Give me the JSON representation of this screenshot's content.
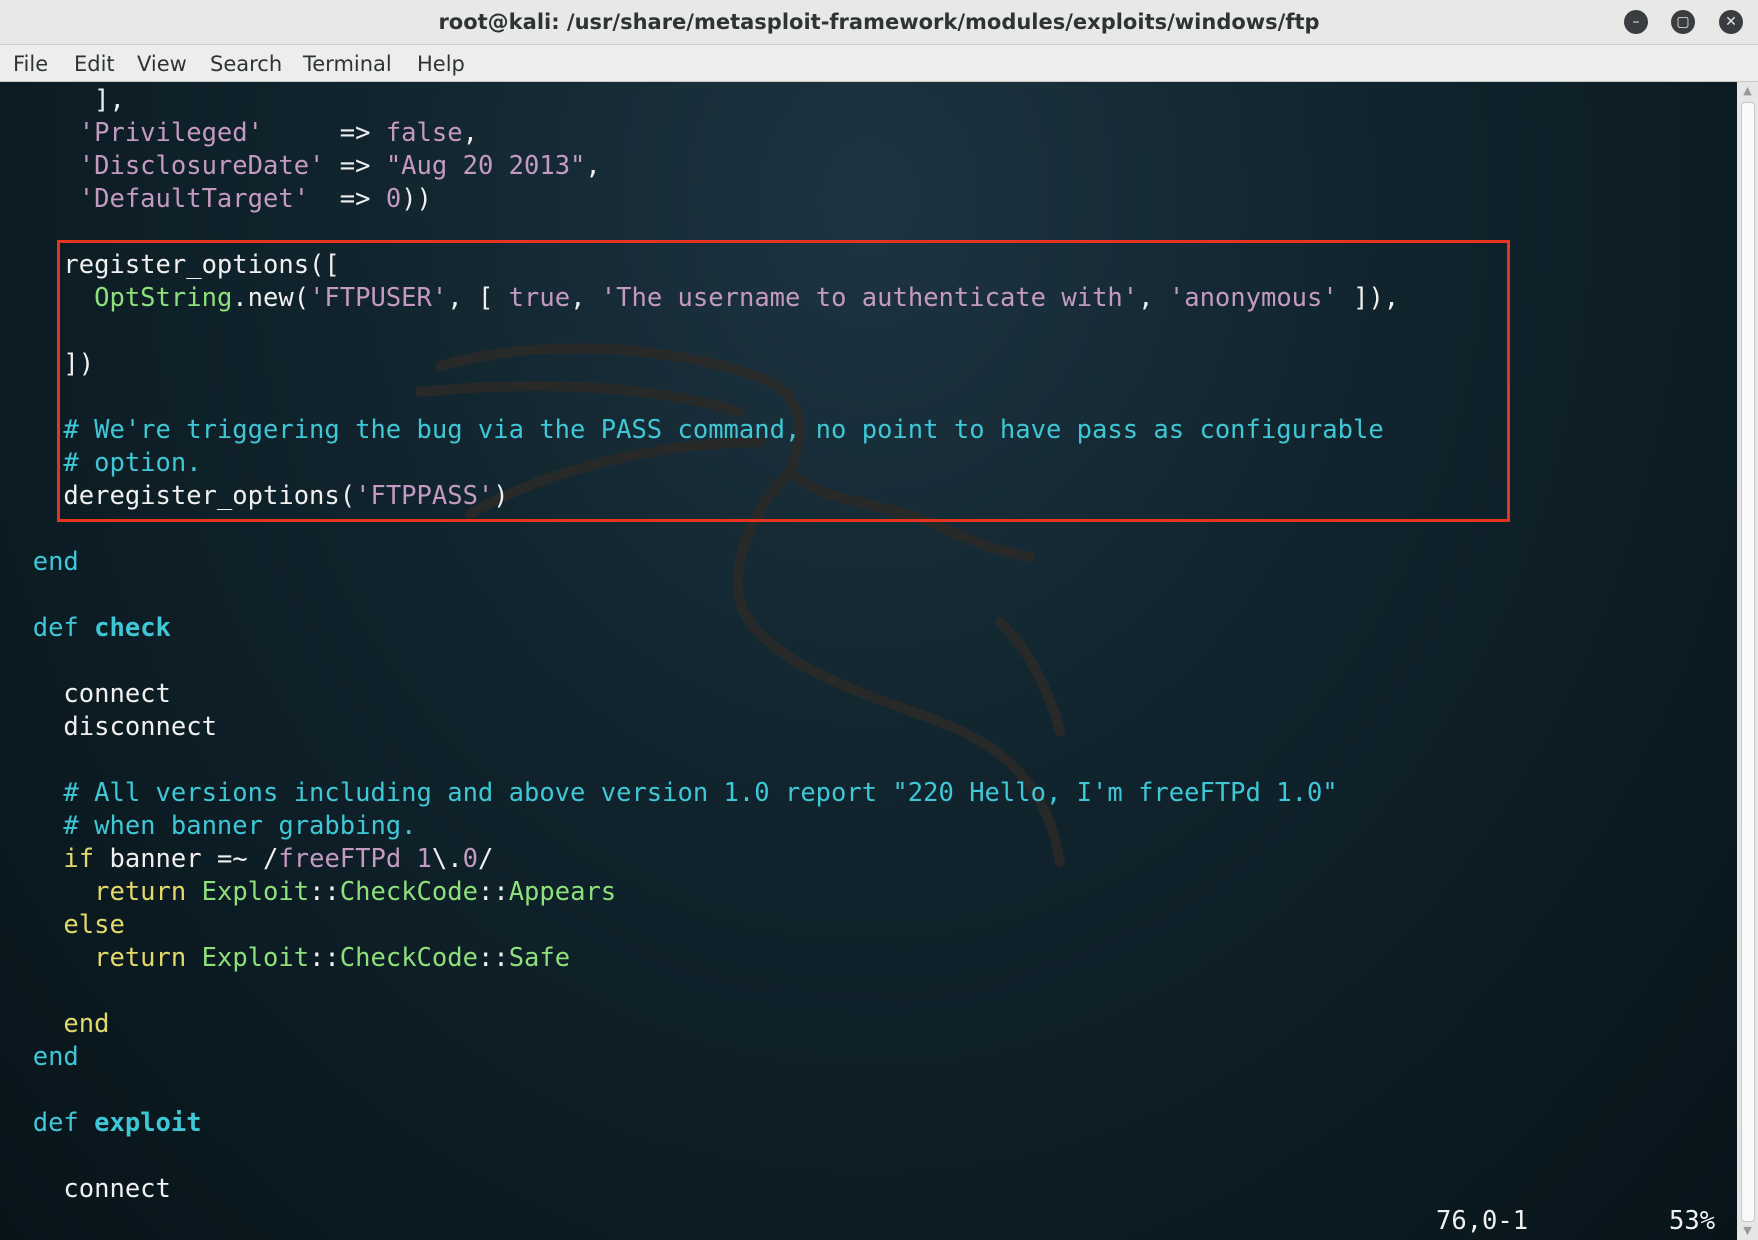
{
  "window": {
    "title": "root@kali: /usr/share/metasploit-framework/modules/exploits/windows/ftp",
    "minimize_glyph": "–",
    "maximize_glyph": "▢",
    "close_glyph": "✕"
  },
  "menu": [
    "File",
    "Edit",
    "View",
    "Search",
    "Terminal",
    "Help"
  ],
  "code": [
    [
      {
        "t": "      ],",
        "c": ""
      }
    ],
    [
      {
        "t": "     ",
        "c": ""
      },
      {
        "t": "'Privileged'",
        "c": "str"
      },
      {
        "t": "     => ",
        "c": ""
      },
      {
        "t": "false",
        "c": "str"
      },
      {
        "t": ",",
        "c": ""
      }
    ],
    [
      {
        "t": "     ",
        "c": ""
      },
      {
        "t": "'DisclosureDate'",
        "c": "str"
      },
      {
        "t": " => ",
        "c": ""
      },
      {
        "t": "\"Aug 20 2013\"",
        "c": "str"
      },
      {
        "t": ",",
        "c": ""
      }
    ],
    [
      {
        "t": "     ",
        "c": ""
      },
      {
        "t": "'DefaultTarget'",
        "c": "str"
      },
      {
        "t": "  => ",
        "c": ""
      },
      {
        "t": "0",
        "c": "str"
      },
      {
        "t": "))",
        "c": ""
      }
    ],
    [],
    [
      {
        "t": "    register_options([",
        "c": ""
      }
    ],
    [
      {
        "t": "      ",
        "c": ""
      },
      {
        "t": "OptString",
        "c": "grn"
      },
      {
        "t": ".new(",
        "c": ""
      },
      {
        "t": "'FTPUSER'",
        "c": "str"
      },
      {
        "t": ", [ ",
        "c": ""
      },
      {
        "t": "true",
        "c": "str"
      },
      {
        "t": ", ",
        "c": ""
      },
      {
        "t": "'The username to authenticate with'",
        "c": "str"
      },
      {
        "t": ", ",
        "c": ""
      },
      {
        "t": "'anonymous'",
        "c": "str"
      },
      {
        "t": " ]),",
        "c": ""
      }
    ],
    [],
    [
      {
        "t": "    ])",
        "c": ""
      }
    ],
    [],
    [
      {
        "t": "    # We're triggering the bug via the PASS command, no point to have pass as configurable",
        "c": "cmt"
      }
    ],
    [
      {
        "t": "    # option.",
        "c": "cmt"
      }
    ],
    [
      {
        "t": "    deregister_options(",
        "c": ""
      },
      {
        "t": "'FTPPASS'",
        "c": "str"
      },
      {
        "t": ")",
        "c": ""
      }
    ],
    [],
    [
      {
        "t": "  ",
        "c": ""
      },
      {
        "t": "end",
        "c": "cyan"
      }
    ],
    [],
    [
      {
        "t": "  ",
        "c": ""
      },
      {
        "t": "def",
        "c": "cyan"
      },
      {
        "t": " ",
        "c": ""
      },
      {
        "t": "check",
        "c": "cyanb"
      }
    ],
    [],
    [
      {
        "t": "    connect",
        "c": ""
      }
    ],
    [
      {
        "t": "    disconnect",
        "c": ""
      }
    ],
    [],
    [
      {
        "t": "    # All versions including and above version 1.0 report \"220 Hello, I'm freeFTPd 1.0\"",
        "c": "cmt"
      }
    ],
    [
      {
        "t": "    # when banner grabbing.",
        "c": "cmt"
      }
    ],
    [
      {
        "t": "    ",
        "c": ""
      },
      {
        "t": "if",
        "c": "yel"
      },
      {
        "t": " banner =~ ",
        "c": ""
      },
      {
        "t": "/",
        "c": ""
      },
      {
        "t": "freeFTPd 1",
        "c": "str"
      },
      {
        "t": "\\.",
        "c": ""
      },
      {
        "t": "0",
        "c": "str"
      },
      {
        "t": "/",
        "c": ""
      }
    ],
    [
      {
        "t": "      ",
        "c": ""
      },
      {
        "t": "return",
        "c": "yel"
      },
      {
        "t": " ",
        "c": ""
      },
      {
        "t": "Exploit",
        "c": "grn"
      },
      {
        "t": "::",
        "c": ""
      },
      {
        "t": "CheckCode",
        "c": "grn"
      },
      {
        "t": "::",
        "c": ""
      },
      {
        "t": "Appears",
        "c": "grn"
      }
    ],
    [
      {
        "t": "    ",
        "c": ""
      },
      {
        "t": "else",
        "c": "yel"
      }
    ],
    [
      {
        "t": "      ",
        "c": ""
      },
      {
        "t": "return",
        "c": "yel"
      },
      {
        "t": " ",
        "c": ""
      },
      {
        "t": "Exploit",
        "c": "grn"
      },
      {
        "t": "::",
        "c": ""
      },
      {
        "t": "CheckCode",
        "c": "grn"
      },
      {
        "t": "::",
        "c": ""
      },
      {
        "t": "Safe",
        "c": "grn"
      }
    ],
    [],
    [
      {
        "t": "    ",
        "c": ""
      },
      {
        "t": "end",
        "c": "yel"
      }
    ],
    [
      {
        "t": "  ",
        "c": ""
      },
      {
        "t": "end",
        "c": "cyan"
      }
    ],
    [],
    [
      {
        "t": "  ",
        "c": ""
      },
      {
        "t": "def",
        "c": "cyan"
      },
      {
        "t": " ",
        "c": ""
      },
      {
        "t": "exploit",
        "c": "cyanb"
      }
    ],
    [],
    [
      {
        "t": "    connect",
        "c": ""
      }
    ]
  ],
  "status": {
    "position": "76,0-1",
    "percent": "53%"
  },
  "colors": {
    "highlight_box": "#e53420",
    "string": "#c49ac2",
    "comment": "#3fc7d6",
    "keyword_yellow": "#e3d96a",
    "constant_green": "#8ee07a"
  }
}
